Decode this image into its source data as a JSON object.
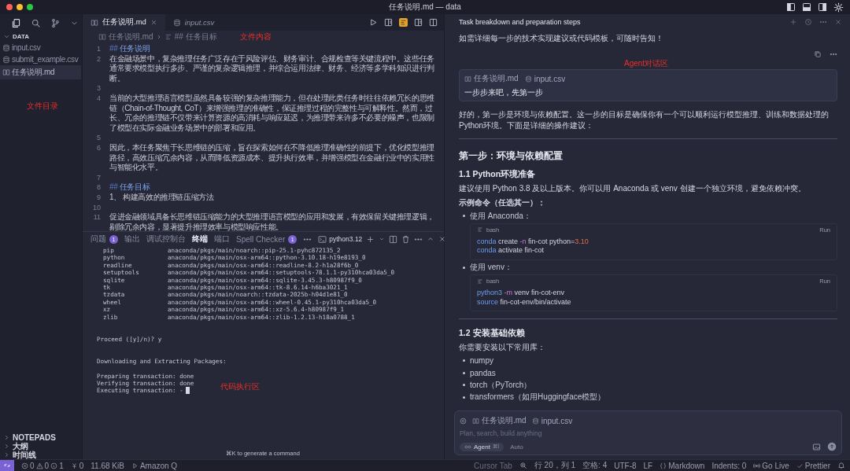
{
  "window": {
    "title": "任务说明.md — data"
  },
  "sidebar": {
    "section": "DATA",
    "expanded": true,
    "files": [
      {
        "name": "input.csv",
        "kind": "csv",
        "selected": false
      },
      {
        "name": "submit_example.csv",
        "kind": "csv",
        "selected": false
      },
      {
        "name": "任务说明.md",
        "kind": "md",
        "selected": true
      }
    ],
    "annotation": "文件目录",
    "bottom_sections": [
      {
        "label": "NOTEPADS",
        "expanded": false
      },
      {
        "label": "大纲",
        "expanded": false
      },
      {
        "label": "时间线",
        "expanded": false
      }
    ]
  },
  "editor": {
    "tabs": [
      {
        "label": "任务说明.md",
        "kind": "md",
        "selected": true
      },
      {
        "label": "input.csv",
        "kind": "csv",
        "selected": false
      }
    ],
    "breadcrumb": [
      "任务说明.md",
      "## 任务目标"
    ],
    "annotation": "文件内容",
    "lines": [
      {
        "number": "1",
        "kind": "heading",
        "marker": "##",
        "text": "任务说明"
      },
      {
        "number": "2",
        "kind": "text",
        "text": "在金融场景中，复杂推理任务广泛存在于风险评估、财务审计、合规检查等关键流程中。这些任务通常要求模型执行多步、严谨的复杂逻辑推理，并综合运用法律、财务、经济等多学科知识进行判断。"
      },
      {
        "number": "3",
        "kind": "blank"
      },
      {
        "number": "4",
        "kind": "text",
        "text": "当前的大型推理语言模型虽然具备较强的复杂推理能力，但在处理此类任务时往往依赖冗长的思维链（Chain-of-Thought, CoT）来增强推理的准确性，保证推理过程的完整性与可解释性。然而，过长、冗余的推理链不仅带来计算资源的高消耗与响应延迟，为推理带来许多不必要的噪声，也限制了模型在实际金融业务场景中的部署和应用。"
      },
      {
        "number": "5",
        "kind": "blank"
      },
      {
        "number": "6",
        "kind": "text",
        "text": "因此，本任务聚焦于长思维链的压缩，旨在探索如何在不降低推理准确性的前提下，优化模型推理路径，高效压缩冗余内容，从而降低资源成本、提升执行效率，并增强模型在金融行业中的实用性与智能化水平。"
      },
      {
        "number": "7",
        "kind": "blank"
      },
      {
        "number": "8",
        "kind": "heading",
        "marker": "##",
        "text": "任务目标"
      },
      {
        "number": "9",
        "kind": "text",
        "text": "1、 构建高效的推理链压缩方法"
      },
      {
        "number": "10",
        "kind": "blank"
      },
      {
        "number": "11",
        "kind": "text",
        "text": "促进金融领域具备长思维链压缩能力的大型推理语言模型的应用和发展，有效保留关键推理逻辑，剔除冗余内容，显著提升推理效率与模型响应性能。"
      }
    ]
  },
  "panel": {
    "tabs": [
      {
        "label": "问题",
        "badge": "1",
        "selected": false
      },
      {
        "label": "输出",
        "selected": false
      },
      {
        "label": "调试控制台",
        "selected": false
      },
      {
        "label": "终端",
        "selected": true
      },
      {
        "label": "端口",
        "selected": false
      },
      {
        "label": "Spell Checker",
        "badge": "1",
        "selected": false
      }
    ],
    "shell": "python3.12",
    "annotation": "代码执行区",
    "terminal": [
      {
        "kind": "package",
        "name": "pip",
        "source": "anaconda/pkgs/main/noarch::pip-25.1-pyhc872135_2"
      },
      {
        "kind": "package",
        "name": "python",
        "source": "anaconda/pkgs/main/osx-arm64::python-3.10.18-h19e8193_0"
      },
      {
        "kind": "package",
        "name": "readline",
        "source": "anaconda/pkgs/main/osx-arm64::readline-8.2-h1a28f6b_0"
      },
      {
        "kind": "package",
        "name": "setuptools",
        "source": "anaconda/pkgs/main/osx-arm64::setuptools-78.1.1-py310hca03da5_0"
      },
      {
        "kind": "package",
        "name": "sqlite",
        "source": "anaconda/pkgs/main/osx-arm64::sqlite-3.45.3-h80987f9_0"
      },
      {
        "kind": "package",
        "name": "tk",
        "source": "anaconda/pkgs/main/osx-arm64::tk-8.6.14-h6ba3021_1"
      },
      {
        "kind": "package",
        "name": "tzdata",
        "source": "anaconda/pkgs/main/noarch::tzdata-2025b-h04d1e81_0"
      },
      {
        "kind": "package",
        "name": "wheel",
        "source": "anaconda/pkgs/main/osx-arm64::wheel-0.45.1-py310hca03da5_0"
      },
      {
        "kind": "package",
        "name": "xz",
        "source": "anaconda/pkgs/main/osx-arm64::xz-5.6.4-h80987f9_1"
      },
      {
        "kind": "package",
        "name": "zlib",
        "source": "anaconda/pkgs/main/osx-arm64::zlib-1.2.13-h18a0788_1"
      },
      {
        "kind": "blank"
      },
      {
        "kind": "blank"
      },
      {
        "kind": "text",
        "text": "Proceed ([y]/n)? y",
        "cursor": false
      },
      {
        "kind": "blank"
      },
      {
        "kind": "blank"
      },
      {
        "kind": "text",
        "text": "Downloading and Extracting Packages:",
        "cursor": false
      },
      {
        "kind": "blank"
      },
      {
        "kind": "text",
        "text": "Preparing transaction: done",
        "cursor": false
      },
      {
        "kind": "text",
        "text": "Verifying transaction: done",
        "cursor": false
      },
      {
        "kind": "text",
        "text": "Executing transaction: -",
        "cursor": true
      }
    ],
    "hint": "⌘K to generate a command"
  },
  "chat": {
    "title": "Task breakdown and preparation steps",
    "annotation": "Agent对话区",
    "blocks": [
      {
        "kind": "p",
        "text": "如需详细每一步的技术实现建议或代码模板，可随时告知！"
      },
      {
        "kind": "actions"
      },
      {
        "kind": "user",
        "chips": [
          {
            "label": "任务说明.md",
            "kind": "md"
          },
          {
            "label": "input.csv",
            "kind": "csv"
          }
        ],
        "text": "一步步来吧，先第一步"
      },
      {
        "kind": "p",
        "text": "好的，第一步是环境与依赖配置。这一步的目标是确保你有一个可以顺利运行模型推理、训练和数据处理的Python环境。下面是详细的操作建议："
      },
      {
        "kind": "hr"
      },
      {
        "kind": "h2",
        "text": "第一步：环境与依赖配置"
      },
      {
        "kind": "h3",
        "text": "1.1 Python环境准备"
      },
      {
        "kind": "p",
        "text": "建议使用 Python 3.8 及以上版本。你可以用 Anaconda 或 venv 创建一个独立环境，避免依赖冲突。"
      },
      {
        "kind": "pb",
        "text": "示例命令（任选其一）："
      },
      {
        "kind": "li",
        "text": "使用 Anaconda："
      },
      {
        "kind": "code",
        "lang": "bash",
        "run": "Run",
        "lines": [
          [
            {
              "text": "conda",
              "kind": "cmd"
            },
            {
              "text": " create",
              "kind": "plain"
            },
            {
              "text": " -n",
              "kind": "flag"
            },
            {
              "text": " fin-cot python=",
              "kind": "plain"
            },
            {
              "text": "3.10",
              "kind": "num"
            }
          ],
          [
            {
              "text": "conda",
              "kind": "cmd"
            },
            {
              "text": " activate fin-cot",
              "kind": "plain"
            }
          ]
        ]
      },
      {
        "kind": "li",
        "text": "使用 venv："
      },
      {
        "kind": "code",
        "lang": "bash",
        "run": "Run",
        "lines": [
          [
            {
              "text": "python3",
              "kind": "cmd"
            },
            {
              "text": " -m",
              "kind": "flag"
            },
            {
              "text": " venv fin-cot-env",
              "kind": "plain"
            }
          ],
          [
            {
              "text": "source",
              "kind": "cmd"
            },
            {
              "text": " fin-cot-env/bin/activate",
              "kind": "plain"
            }
          ]
        ]
      },
      {
        "kind": "hr"
      },
      {
        "kind": "h3",
        "text": "1.2 安装基础依赖"
      },
      {
        "kind": "p",
        "text": "你需要安装以下常用库："
      },
      {
        "kind": "li",
        "text": "numpy"
      },
      {
        "kind": "li",
        "text": "pandas"
      },
      {
        "kind": "li",
        "text": "torch（PyTorch）"
      },
      {
        "kind": "li",
        "text": "transformers（如用Huggingface模型）"
      }
    ],
    "input": {
      "chips": [
        {
          "label": "任务说明.md",
          "kind": "md"
        },
        {
          "label": "input.csv",
          "kind": "csv"
        }
      ],
      "placeholder": "Plan, search, build anything",
      "mode": "Agent",
      "mode_shortcut": "⌘I",
      "model": "Auto"
    }
  },
  "status_bar": {
    "left": [
      {
        "kind": "problems",
        "errors": "0",
        "warnings": "0",
        "info": "1"
      },
      {
        "kind": "ports",
        "text": "0"
      },
      {
        "kind": "plain",
        "text": "11.68 KiB"
      },
      {
        "kind": "run",
        "text": "Amazon Q"
      }
    ],
    "right": [
      {
        "kind": "plain",
        "text": "Cursor Tab",
        "disabled": true
      },
      {
        "kind": "zoom"
      },
      {
        "kind": "plain",
        "text": "行 20，列 1",
        "disabled": false
      },
      {
        "kind": "plain",
        "text": "空格: 4",
        "disabled": false
      },
      {
        "kind": "plain",
        "text": "UTF-8",
        "disabled": false
      },
      {
        "kind": "plain",
        "text": "LF",
        "disabled": false
      },
      {
        "kind": "braces",
        "text": "Markdown",
        "disabled": false
      },
      {
        "kind": "plain",
        "text": "Indents: 0",
        "disabled": false
      },
      {
        "kind": "live",
        "text": "Go Live",
        "disabled": false
      },
      {
        "kind": "check",
        "text": "Prettier",
        "disabled": false
      },
      {
        "kind": "bell"
      }
    ]
  }
}
